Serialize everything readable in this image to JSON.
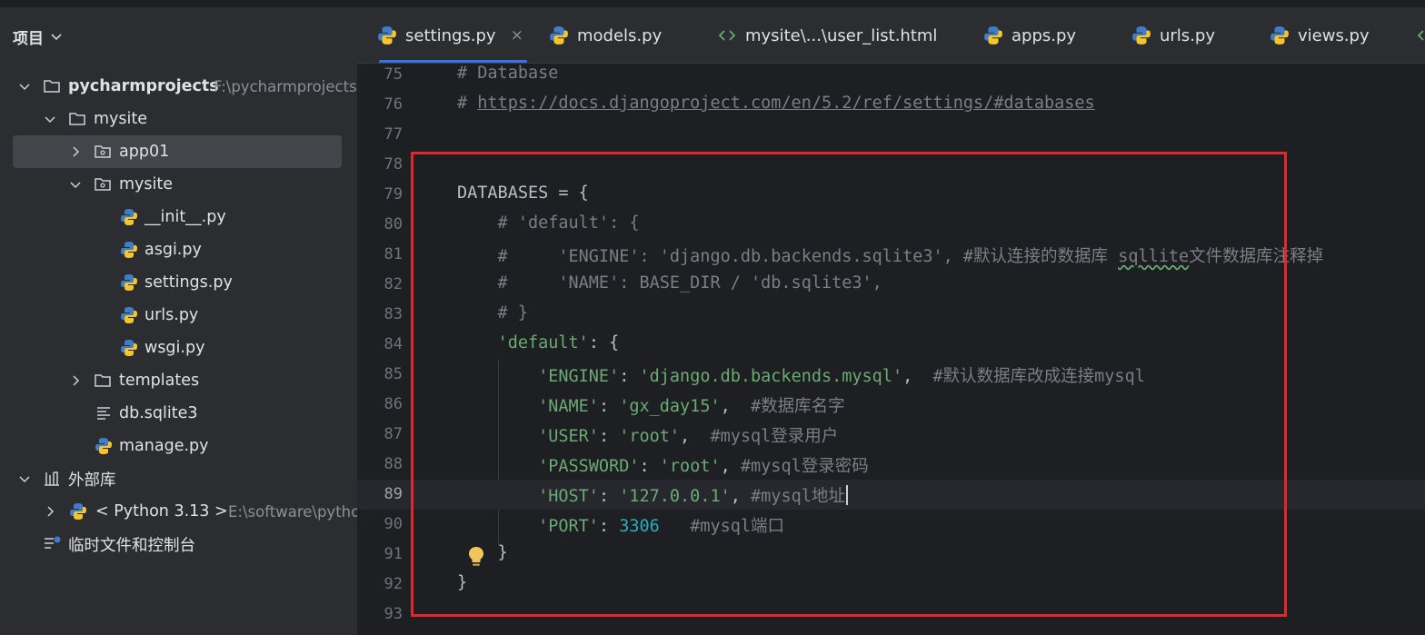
{
  "sidebar": {
    "title": "项目",
    "tree": [
      {
        "label": "pycharmprojects",
        "path": "F:\\pycharmprojects"
      },
      {
        "label": "mysite"
      },
      {
        "label": "app01"
      },
      {
        "label": "mysite"
      },
      {
        "label": "__init__.py"
      },
      {
        "label": "asgi.py"
      },
      {
        "label": "settings.py"
      },
      {
        "label": "urls.py"
      },
      {
        "label": "wsgi.py"
      },
      {
        "label": "templates"
      },
      {
        "label": "db.sqlite3"
      },
      {
        "label": "manage.py"
      },
      {
        "label": "外部库"
      },
      {
        "label": "< Python 3.13 >",
        "path": "E:\\software\\python"
      },
      {
        "label": "临时文件和控制台"
      }
    ]
  },
  "tabs": [
    {
      "label": "settings.py",
      "icon": "python-file-icon",
      "active": true,
      "close": "×"
    },
    {
      "label": "models.py",
      "icon": "python-file-icon"
    },
    {
      "label": "mysite\\...\\user_list.html",
      "icon": "html-file-icon"
    },
    {
      "label": "apps.py",
      "icon": "python-file-icon"
    },
    {
      "label": "urls.py",
      "icon": "python-file-icon"
    },
    {
      "label": "views.py",
      "icon": "python-file-icon"
    }
  ],
  "editor": {
    "current_line": 89,
    "lines": [
      {
        "n": "75",
        "tokens": [
          {
            "t": "# Database",
            "c": "comment"
          }
        ]
      },
      {
        "n": "76",
        "tokens": [
          {
            "t": "# ",
            "c": "comment"
          },
          {
            "t": "https://docs.djangoproject.com/en/5.2/ref/settings/#databases",
            "c": "link"
          }
        ]
      },
      {
        "n": "77",
        "tokens": []
      },
      {
        "n": "78",
        "tokens": []
      },
      {
        "n": "79",
        "tokens": [
          {
            "t": "DATABASES = {",
            "c": "plain"
          }
        ]
      },
      {
        "n": "80",
        "tokens": [
          {
            "t": "    # 'default': {",
            "c": "comment"
          }
        ]
      },
      {
        "n": "81",
        "tokens": [
          {
            "t": "    #     'ENGINE': 'django.db.backends.sqlite3', #默认连接的数据库 ",
            "c": "comment"
          },
          {
            "t": "sqllite",
            "c": "comment squig"
          },
          {
            "t": "文件数据库注释掉",
            "c": "comment"
          }
        ]
      },
      {
        "n": "82",
        "tokens": [
          {
            "t": "    #     'NAME': BASE_DIR / 'db.sqlite3',",
            "c": "comment"
          }
        ]
      },
      {
        "n": "83",
        "tokens": [
          {
            "t": "    # }",
            "c": "comment"
          }
        ]
      },
      {
        "n": "84",
        "tokens": [
          {
            "t": "    ",
            "c": "plain"
          },
          {
            "t": "'default'",
            "c": "str"
          },
          {
            "t": ": {",
            "c": "plain"
          }
        ]
      },
      {
        "n": "85",
        "tokens": [
          {
            "t": "        ",
            "c": "plain"
          },
          {
            "t": "'ENGINE'",
            "c": "str"
          },
          {
            "t": ": ",
            "c": "plain"
          },
          {
            "t": "'django.db.backends.mysql'",
            "c": "str"
          },
          {
            "t": ",  ",
            "c": "plain"
          },
          {
            "t": "#默认数据库改成连接mysql",
            "c": "comment"
          }
        ]
      },
      {
        "n": "86",
        "tokens": [
          {
            "t": "        ",
            "c": "plain"
          },
          {
            "t": "'NAME'",
            "c": "str"
          },
          {
            "t": ": ",
            "c": "plain"
          },
          {
            "t": "'gx_day15'",
            "c": "str"
          },
          {
            "t": ",  ",
            "c": "plain"
          },
          {
            "t": "#数据库名字",
            "c": "comment"
          }
        ]
      },
      {
        "n": "87",
        "tokens": [
          {
            "t": "        ",
            "c": "plain"
          },
          {
            "t": "'USER'",
            "c": "str"
          },
          {
            "t": ": ",
            "c": "plain"
          },
          {
            "t": "'root'",
            "c": "str"
          },
          {
            "t": ",  ",
            "c": "plain"
          },
          {
            "t": "#mysql登录用户",
            "c": "comment"
          }
        ]
      },
      {
        "n": "88",
        "tokens": [
          {
            "t": "        ",
            "c": "plain"
          },
          {
            "t": "'PASSWORD'",
            "c": "str"
          },
          {
            "t": ": ",
            "c": "plain"
          },
          {
            "t": "'root'",
            "c": "str"
          },
          {
            "t": ", ",
            "c": "plain"
          },
          {
            "t": "#mysql登录密码",
            "c": "comment"
          }
        ]
      },
      {
        "n": "89",
        "tokens": [
          {
            "t": "        ",
            "c": "plain"
          },
          {
            "t": "'HOST'",
            "c": "str"
          },
          {
            "t": ": ",
            "c": "plain"
          },
          {
            "t": "'127.0.0.1'",
            "c": "str"
          },
          {
            "t": ", ",
            "c": "plain"
          },
          {
            "t": "#mysql地址",
            "c": "comment"
          }
        ]
      },
      {
        "n": "90",
        "tokens": [
          {
            "t": "        ",
            "c": "plain"
          },
          {
            "t": "'PORT'",
            "c": "str"
          },
          {
            "t": ": ",
            "c": "plain"
          },
          {
            "t": "3306",
            "c": "num"
          },
          {
            "t": "   ",
            "c": "plain"
          },
          {
            "t": "#mysql端口",
            "c": "comment"
          }
        ]
      },
      {
        "n": "91",
        "tokens": [
          {
            "t": "    }",
            "c": "plain"
          }
        ]
      },
      {
        "n": "92",
        "tokens": [
          {
            "t": "}",
            "c": "plain"
          }
        ]
      },
      {
        "n": "93",
        "tokens": []
      }
    ]
  },
  "colors": {
    "accent": "#3574f0",
    "highlight_box": "#e3262b",
    "string": "#6aab73",
    "comment": "#7a7e85",
    "number": "#2aacb8"
  }
}
